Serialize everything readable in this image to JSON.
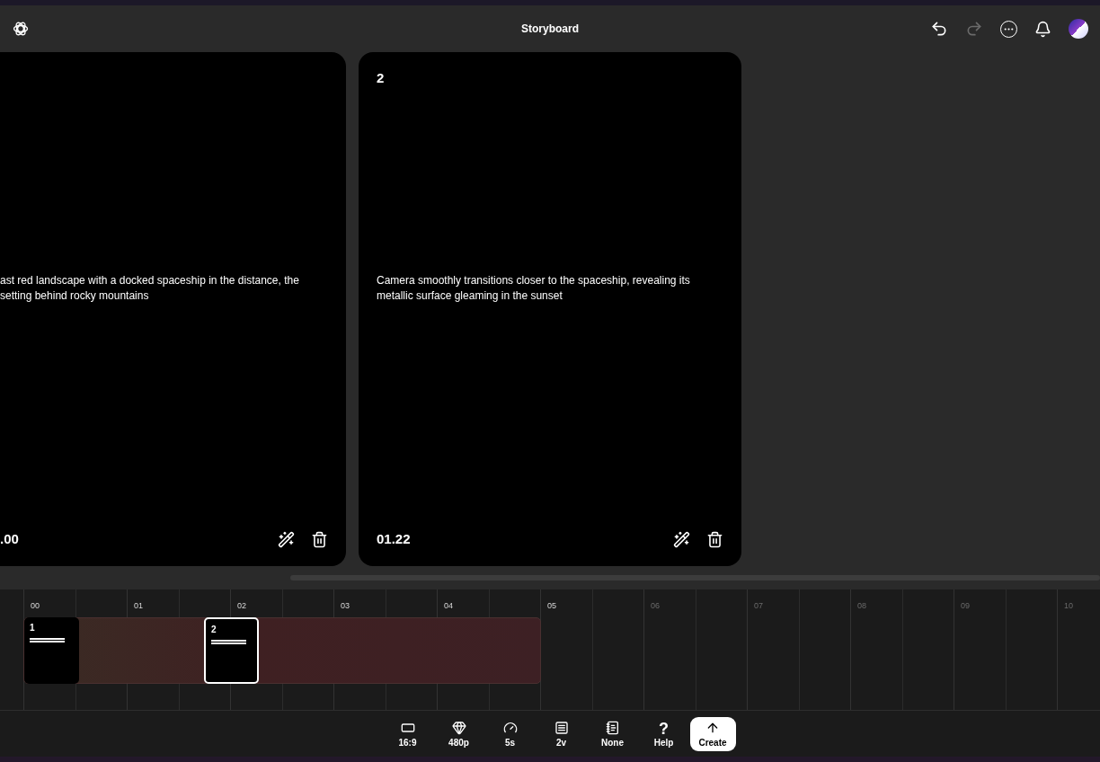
{
  "header": {
    "title": "Storyboard"
  },
  "cards": [
    {
      "description": "ast red landscape with a docked spaceship in the distance, the setting behind rocky mountains",
      "time": ".00",
      "cut": true
    },
    {
      "number": "2",
      "description": "Camera smoothly transitions closer to the spaceship, revealing its metallic surface gleaming in the sunset",
      "time": "01.22",
      "cut": false
    }
  ],
  "timeline": {
    "ticks": [
      {
        "label": "00",
        "active": true
      },
      {
        "label": "01",
        "active": true
      },
      {
        "label": "02",
        "active": true
      },
      {
        "label": "03",
        "active": true
      },
      {
        "label": "04",
        "active": true
      },
      {
        "label": "05",
        "active": true
      },
      {
        "label": "06",
        "active": false
      },
      {
        "label": "07",
        "active": false
      },
      {
        "label": "08",
        "active": false
      },
      {
        "label": "09",
        "active": false
      },
      {
        "label": "10",
        "active": false
      }
    ],
    "clips": [
      {
        "number": "1",
        "selected": false
      },
      {
        "number": "2",
        "selected": true
      }
    ]
  },
  "toolbar": [
    {
      "kind": "ratio",
      "label": "16:9"
    },
    {
      "kind": "quality",
      "label": "480p"
    },
    {
      "kind": "duration",
      "label": "5s"
    },
    {
      "kind": "variations",
      "label": "2v"
    },
    {
      "kind": "preset",
      "label": "None"
    },
    {
      "kind": "help",
      "label": "Help",
      "glyph": "?"
    },
    {
      "kind": "create",
      "label": "Create"
    }
  ]
}
